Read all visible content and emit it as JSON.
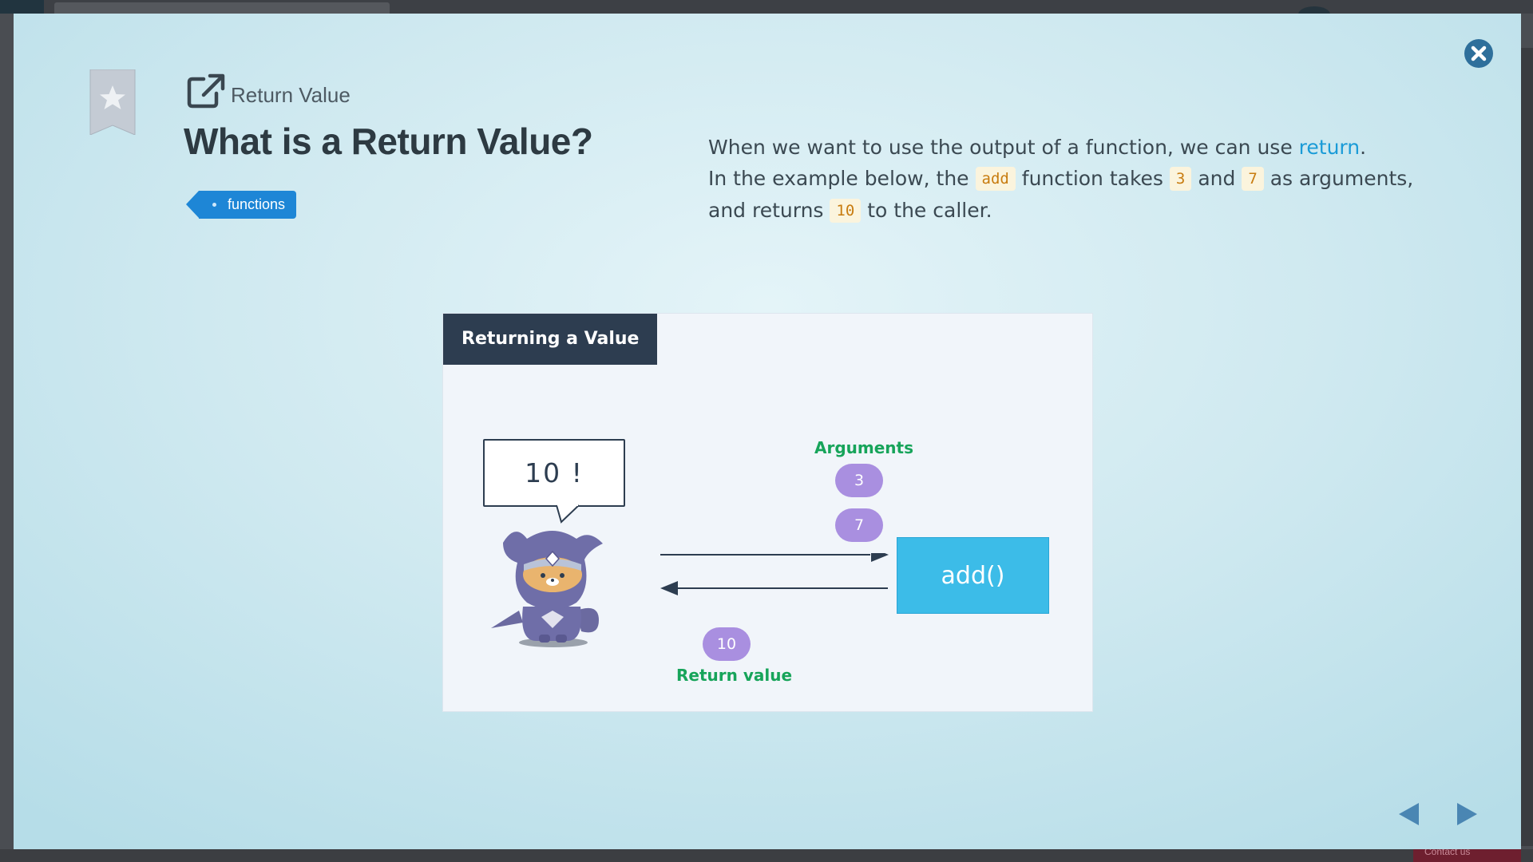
{
  "modal": {
    "header": {
      "subtitle": "Return Value",
      "title": "What is a Return Value?",
      "tag": "functions"
    },
    "description": {
      "line1_text": "When we want to use the output of a function, we can use ",
      "line1_link": "return",
      "line1_end": ".",
      "line2_a": "In the example below, the ",
      "line2_code1": "add",
      "line2_b": " function takes ",
      "line2_code2": "3",
      "line2_c": " and ",
      "line2_code3": "7",
      "line2_d": " as arguments,",
      "line3_a": "and returns ",
      "line3_code": "10",
      "line3_b": " to the caller."
    },
    "diagram": {
      "title": "Returning a Value",
      "speech": "10 !",
      "arguments_label": "Arguments",
      "arg1": "3",
      "arg2": "7",
      "function_label": "add()",
      "return_pill": "10",
      "return_label": "Return value"
    }
  },
  "background": {
    "contact_button": "Contact us"
  },
  "colors": {
    "accent_blue": "#1e86d6",
    "link": "#1a9bd7",
    "function_box": "#3cbce8",
    "pill": "#a98fe0",
    "label_green": "#17a45a",
    "dark_navy": "#2d3d50"
  },
  "icons": {
    "close": "close-icon",
    "bookmark": "bookmark-star-icon",
    "external": "external-link-icon",
    "prev": "prev-arrow-icon",
    "next": "next-arrow-icon"
  }
}
